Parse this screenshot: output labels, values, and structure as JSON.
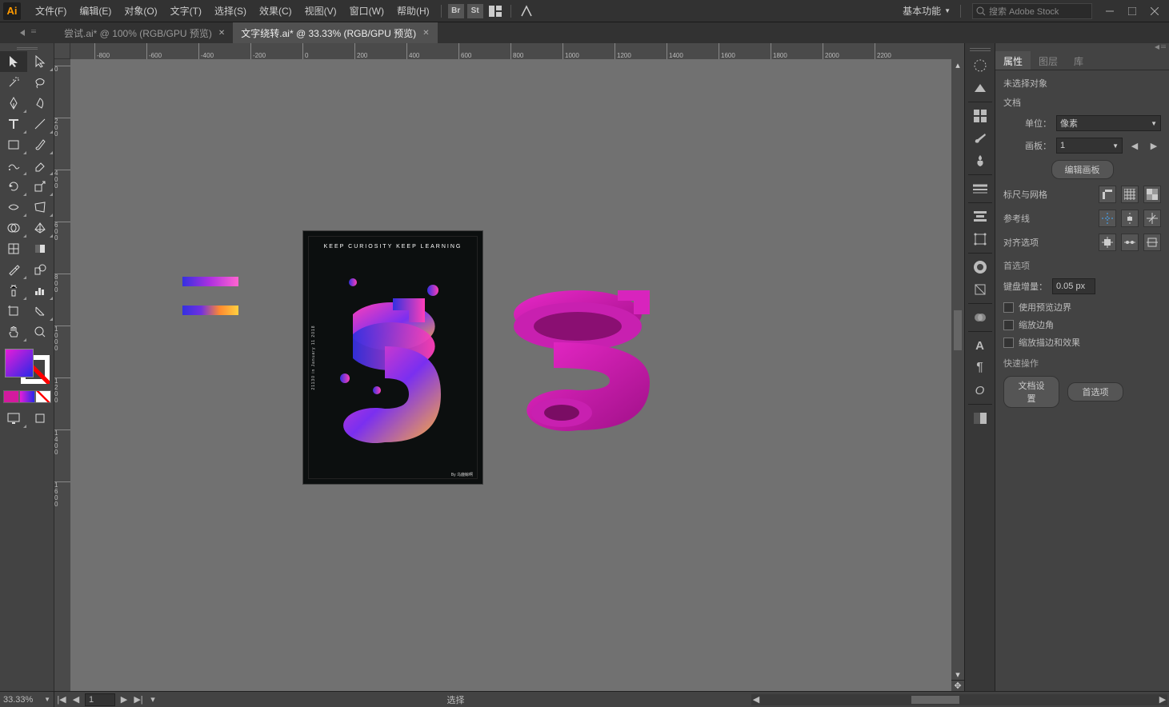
{
  "app": {
    "logo": "Ai"
  },
  "menu": {
    "file": "文件(F)",
    "edit": "编辑(E)",
    "object": "对象(O)",
    "type": "文字(T)",
    "select": "选择(S)",
    "effect": "效果(C)",
    "view": "视图(V)",
    "window": "窗口(W)",
    "help": "帮助(H)",
    "br": "Br",
    "st": "St"
  },
  "workspace": {
    "label": "基本功能"
  },
  "search": {
    "placeholder": "搜索 Adobe Stock"
  },
  "tabs": [
    {
      "label": "尝试.ai* @ 100% (RGB/GPU 预览)",
      "active": false
    },
    {
      "label": "文字绕转.ai* @ 33.33% (RGB/GPU 预览)",
      "active": true
    }
  ],
  "ruler_h": [
    "-800",
    "-600",
    "-400",
    "-200",
    "0",
    "200",
    "400",
    "600",
    "800",
    "1000",
    "1200",
    "1400",
    "1600",
    "1800",
    "2000",
    "2200"
  ],
  "ruler_v": [
    "0",
    "200",
    "400",
    "600",
    "800",
    "1000",
    "1200",
    "1400",
    "1600"
  ],
  "artboard": {
    "title": "KEEP CURIOSITY KEEP LEARNING",
    "side": "21130 in January 11 2018",
    "foot": "By 乌鹿鲸啊"
  },
  "panel": {
    "tabs": {
      "props": "属性",
      "layers": "图层",
      "libraries": "库"
    },
    "no_selection": "未选择对象",
    "document": "文档",
    "unit_label": "单位：",
    "unit_value": "像素",
    "artboard_label": "画板：",
    "artboard_value": "1",
    "edit_artboards": "编辑画板",
    "rulers_grid": "标尺与网格",
    "guides": "参考线",
    "align_options": "对齐选项",
    "prefs": "首选项",
    "key_inc_label": "键盘增量：",
    "key_inc_value": "0.05 px",
    "use_preview_bounds": "使用预览边界",
    "scale_corners": "缩放边角",
    "scale_strokes": "缩放描边和效果",
    "quick_actions": "快速操作",
    "doc_setup": "文档设置",
    "preferences_btn": "首选项"
  },
  "status": {
    "zoom": "33.33%",
    "artboard_num": "1",
    "select_label": "选择"
  }
}
